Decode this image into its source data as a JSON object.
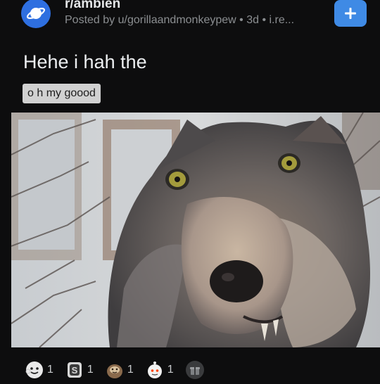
{
  "post": {
    "subreddit": "r/ambien",
    "byline": "Posted by u/gorillaandmonkeypew • 3d • i.re...",
    "title": "Hehe i hah the",
    "flair": "o h my goood",
    "join_label": "+"
  },
  "image": {
    "subject": "wolf close-up photo",
    "colors": {
      "fur_dark": "#4d4a49",
      "fur_light": "#b9aca0",
      "background": "#cfd3d6",
      "eye": "#a39b3c"
    }
  },
  "awards": [
    {
      "icon": "wholesome-award-icon",
      "count": "1"
    },
    {
      "icon": "silver-award-icon",
      "count": "1"
    },
    {
      "icon": "sloth-award-icon",
      "count": "1"
    },
    {
      "icon": "helpful-award-icon",
      "count": "1"
    }
  ],
  "colors": {
    "accent": "#3f8ae5",
    "subreddit_icon": "#2e6fe0",
    "background": "#0d0d0e"
  }
}
